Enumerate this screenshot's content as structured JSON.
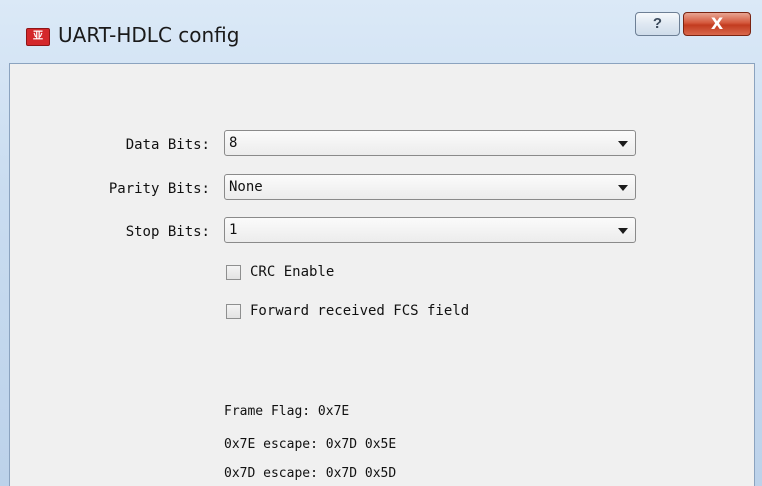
{
  "window": {
    "title": "UART-HDLC config",
    "icon_text": "亚",
    "help_label": "?",
    "close_label": "X"
  },
  "form": {
    "data_bits": {
      "label": "Data Bits:",
      "value": "8"
    },
    "parity_bits": {
      "label": "Parity Bits:",
      "value": "None"
    },
    "stop_bits": {
      "label": "Stop Bits:",
      "value": "1"
    },
    "crc_enable": {
      "label": "CRC Enable",
      "checked": false
    },
    "forward_fcs": {
      "label": "Forward received FCS field",
      "checked": false
    }
  },
  "info": {
    "frame_flag": "Frame Flag: 0x7E",
    "escape_7e": "0x7E escape: 0x7D 0x5E",
    "escape_7d": "0x7D escape: 0x7D 0x5D"
  }
}
